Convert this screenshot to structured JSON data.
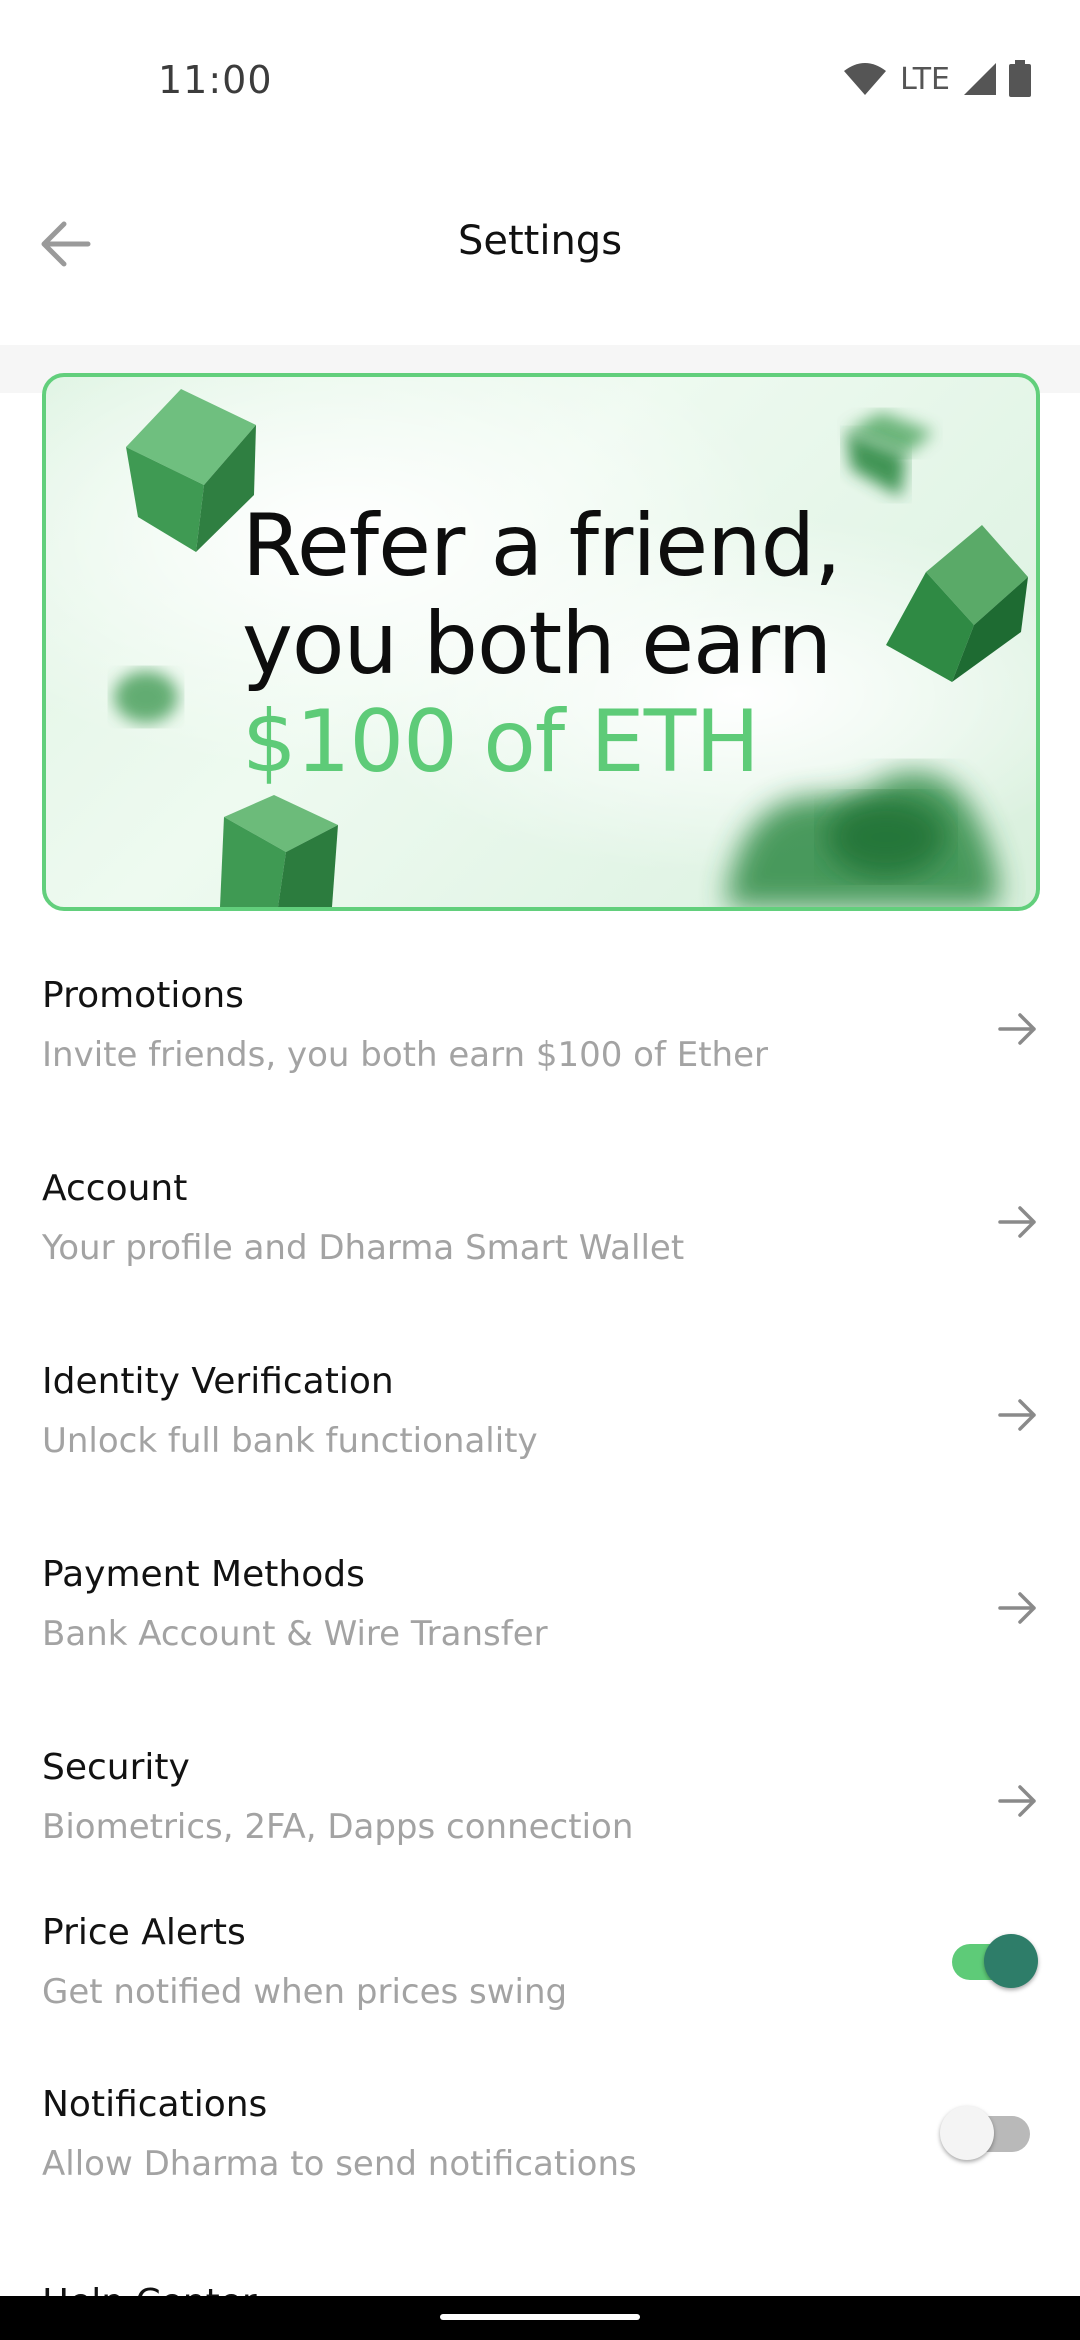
{
  "status_bar": {
    "time": "11:00",
    "network": "LTE",
    "icons": [
      "wifi-icon",
      "signal-icon",
      "battery-icon"
    ]
  },
  "header": {
    "title": "Settings",
    "back_icon": "arrow-left-icon"
  },
  "banner": {
    "line1": "Refer a friend,",
    "line2": "you both earn",
    "line3": "$100 of ETH",
    "accent_color": "#5ecb78",
    "border_color": "#62cf7c"
  },
  "settings": {
    "items": [
      {
        "title": "Promotions",
        "subtitle": "Invite friends, you both earn $100 of Ether",
        "icon": "arrow-right-icon"
      },
      {
        "title": "Account",
        "subtitle": "Your profile and Dharma Smart Wallet",
        "icon": "arrow-right-icon"
      },
      {
        "title": "Identity Verification",
        "subtitle": "Unlock full bank functionality",
        "icon": "arrow-right-icon"
      },
      {
        "title": "Payment Methods",
        "subtitle": "Bank Account & Wire Transfer",
        "icon": "arrow-right-icon"
      },
      {
        "title": "Security",
        "subtitle": "Biometrics, 2FA, Dapps connection",
        "icon": "arrow-right-icon"
      }
    ],
    "toggles": [
      {
        "title": "Price Alerts",
        "subtitle": "Get notified when prices swing",
        "enabled": true
      },
      {
        "title": "Notifications",
        "subtitle": "Allow Dharma to send notifications",
        "enabled": false
      }
    ],
    "cut_off_item": "Help Center"
  },
  "colors": {
    "toggle_on_track": "#5ecb78",
    "toggle_on_thumb": "#2e7d69",
    "subtitle": "#a3a3a3"
  }
}
